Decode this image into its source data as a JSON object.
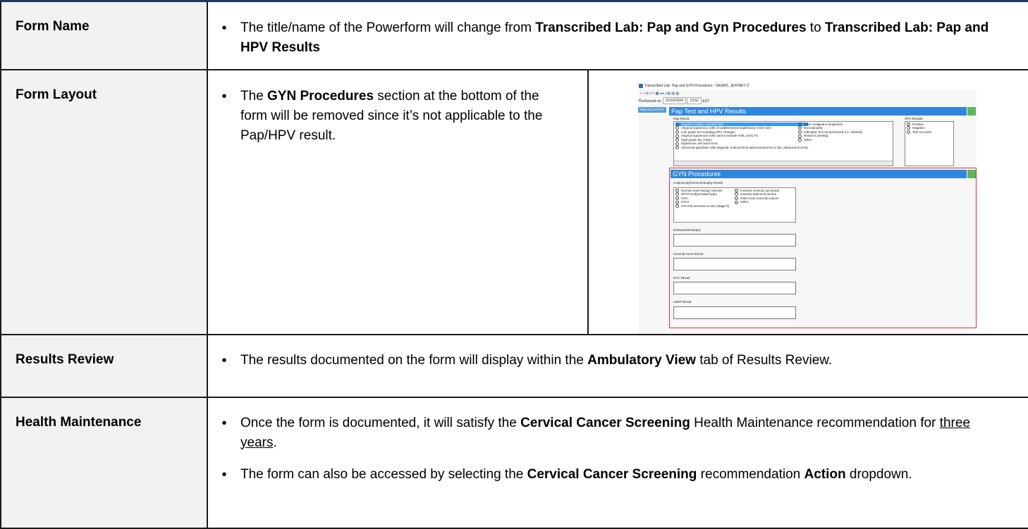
{
  "rows": [
    {
      "label": "Form Name",
      "bullets": [
        [
          {
            "t": "The title/name of the Powerform will change from "
          },
          {
            "t": "Transcribed Lab: Pap and Gyn Procedures",
            "b": true
          },
          {
            "t": " to "
          },
          {
            "t": "Transcribed Lab: Pap and HPV Results",
            "b": true
          }
        ]
      ]
    },
    {
      "label": "Form Layout",
      "bullets": [
        [
          {
            "t": "The "
          },
          {
            "t": "GYN Procedures",
            "b": true
          },
          {
            "t": " section at the bottom of the form will be removed since it’s not applicable to the Pap/HPV result."
          }
        ]
      ]
    },
    {
      "label": "Results Review",
      "bullets": [
        [
          {
            "t": "The results documented on the form will display within the "
          },
          {
            "t": "Ambulatory View",
            "b": true
          },
          {
            "t": " tab of Results Review."
          }
        ]
      ]
    },
    {
      "label": "Health Maintenance",
      "bullets": [
        [
          {
            "t": "Once the form is documented, it will satisfy the "
          },
          {
            "t": "Cervical Cancer Screening",
            "b": true
          },
          {
            "t": " Health Maintenance recommendation for "
          },
          {
            "t": "three years",
            "u": true
          },
          {
            "t": "."
          }
        ],
        [
          {
            "t": "The form can also be accessed by selecting the "
          },
          {
            "t": "Cervical Cancer Screening",
            "b": true
          },
          {
            "t": " recommendation "
          },
          {
            "t": "Action",
            "b": true
          },
          {
            "t": " dropdown."
          }
        ]
      ]
    }
  ],
  "screenshot": {
    "window_title": "Transcribed Lab: Pap and GYN Procedures - SAUMS, JEFFREY D",
    "toolbar_glyphs": "✓ ▪ ⊘ | ✂ ▦ ◂ ▸ | ▤ ▥ ▧",
    "performed_label": "*Performed on:",
    "date": "01/10/2024",
    "time": "13:52",
    "tz": "EST",
    "nav_tab": "Pap and GYN Pr",
    "pap_section_title": "Pap Test and HPV Results",
    "pap_result_label": "Pap Result",
    "pap_col1": [
      "Negative (within normal limits)",
      "Atypical squamous cells of undetermined significance (ASC-US)",
      "Low grade SIL including HPV changes",
      "Atypical squamous cells cannot exclude HSIL (ASC-H)",
      "High grade SIL (HSIL)",
      "Squamous cell carcinoma",
      "Abnormal glandular cells (atypical, endocervical adenocarcinoma in situ, adenocarcinoma)"
    ],
    "pap_col2": [
      "Other malignant neoplasms",
      "Not indicated",
      "Indicated, but not performed (i.e. refused)",
      "Result is pending",
      "Other"
    ],
    "hpv_label": "HPV Results",
    "hpv_options": [
      "Positive",
      "Negative",
      "Test not done"
    ],
    "gyn_section_title": "GYN Procedures",
    "colpo_label": "Colposcopy/Cervical Biopsy Result",
    "colpo_col1": [
      "Normal exam benign reaction",
      "HPV/Condylomata/Atypia",
      "CIN I",
      "CIN II",
      "CIN III/Carcinoma in-situ (stage 0)"
    ],
    "colpo_col2": [
      "Invasive cervical carcinoma",
      "Invasive adenocarcinoma",
      "Other (non-cervical) cancer",
      "Other"
    ],
    "endometrial_label": "Endometrial Biopsy",
    "cone_label": "Cervical Cone Result",
    "ecc_label": "ECC Result",
    "leep_label": "LEEP Result"
  }
}
